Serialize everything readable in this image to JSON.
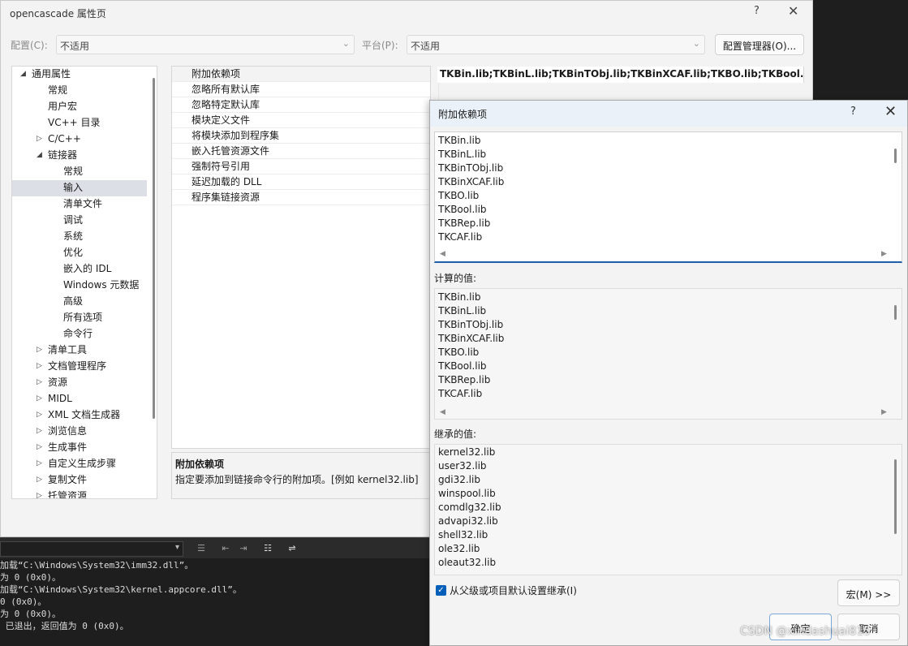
{
  "dialog": {
    "title": "opencascade 属性页",
    "help": "?",
    "close": "✕",
    "config_label": "配置(C):",
    "config_value": "不适用",
    "platform_label": "平台(P):",
    "platform_value": "不适用",
    "config_manager": "配置管理器(O)..."
  },
  "tree": {
    "items": [
      {
        "label": "通用属性",
        "expanded": true
      },
      {
        "label": "常规"
      },
      {
        "label": "用户宏"
      },
      {
        "label": "VC++ 目录"
      },
      {
        "label": "C/C++"
      },
      {
        "label": "链接器",
        "expanded": true
      },
      {
        "label": "常规"
      },
      {
        "label": "输入",
        "selected": true
      },
      {
        "label": "清单文件"
      },
      {
        "label": "调试"
      },
      {
        "label": "系统"
      },
      {
        "label": "优化"
      },
      {
        "label": "嵌入的 IDL"
      },
      {
        "label": "Windows 元数据"
      },
      {
        "label": "高级"
      },
      {
        "label": "所有选项"
      },
      {
        "label": "命令行"
      },
      {
        "label": "清单工具"
      },
      {
        "label": "文档管理程序"
      },
      {
        "label": "资源"
      },
      {
        "label": "MIDL"
      },
      {
        "label": "XML 文档生成器"
      },
      {
        "label": "浏览信息"
      },
      {
        "label": "生成事件"
      },
      {
        "label": "自定义生成步骤"
      },
      {
        "label": "复制文件"
      },
      {
        "label": "托管资源"
      }
    ]
  },
  "grid": {
    "rows": [
      "附加依赖项",
      "忽略所有默认库",
      "忽略特定默认库",
      "模块定义文件",
      "将模块添加到程序集",
      "嵌入托管资源文件",
      "强制符号引用",
      "延迟加载的 DLL",
      "程序集链接资源"
    ],
    "first_value": "TKBin.lib;TKBinL.lib;TKBinTObj.lib;TKBinXCAF.lib;TKBO.lib;TKBool.lib;TKBRep.lib"
  },
  "description": {
    "title": "附加依赖项",
    "text": "指定要添加到链接命令行的附加项。[例如 kernel32.lib]"
  },
  "popup": {
    "title": "附加依赖项",
    "help": "?",
    "close": "✕",
    "edit_lines": [
      "TKBin.lib",
      "TKBinL.lib",
      "TKBinTObj.lib",
      "TKBinXCAF.lib",
      "TKBO.lib",
      "TKBool.lib",
      "TKBRep.lib",
      "TKCAF.lib"
    ],
    "computed_label": "计算的值:",
    "computed_lines": [
      "TKBin.lib",
      "TKBinL.lib",
      "TKBinTObj.lib",
      "TKBinXCAF.lib",
      "TKBO.lib",
      "TKBool.lib",
      "TKBRep.lib",
      "TKCAF.lib"
    ],
    "inherited_label": "继承的值:",
    "inherited_lines": [
      "kernel32.lib",
      "user32.lib",
      "gdi32.lib",
      "winspool.lib",
      "comdlg32.lib",
      "advapi32.lib",
      "shell32.lib",
      "ole32.lib",
      "oleaut32.lib"
    ],
    "inherit_checkbox": "从父级或项目默认设置继承(I)",
    "macro_button": "宏(M) >>",
    "ok_button": "确定",
    "cancel_button": "取消"
  },
  "output": {
    "lines": [
      "加载“C:\\Windows\\System32\\imm32.dll”。",
      "为 0 (0x0)。",
      "加载“C:\\Windows\\System32\\kernel.appcore.dll”。",
      "0 (0x0)。",
      "为 0 (0x0)。",
      " 已退出，返回值为 0 (0x0)。"
    ]
  },
  "watermark": "CSDN @xindashuai815"
}
